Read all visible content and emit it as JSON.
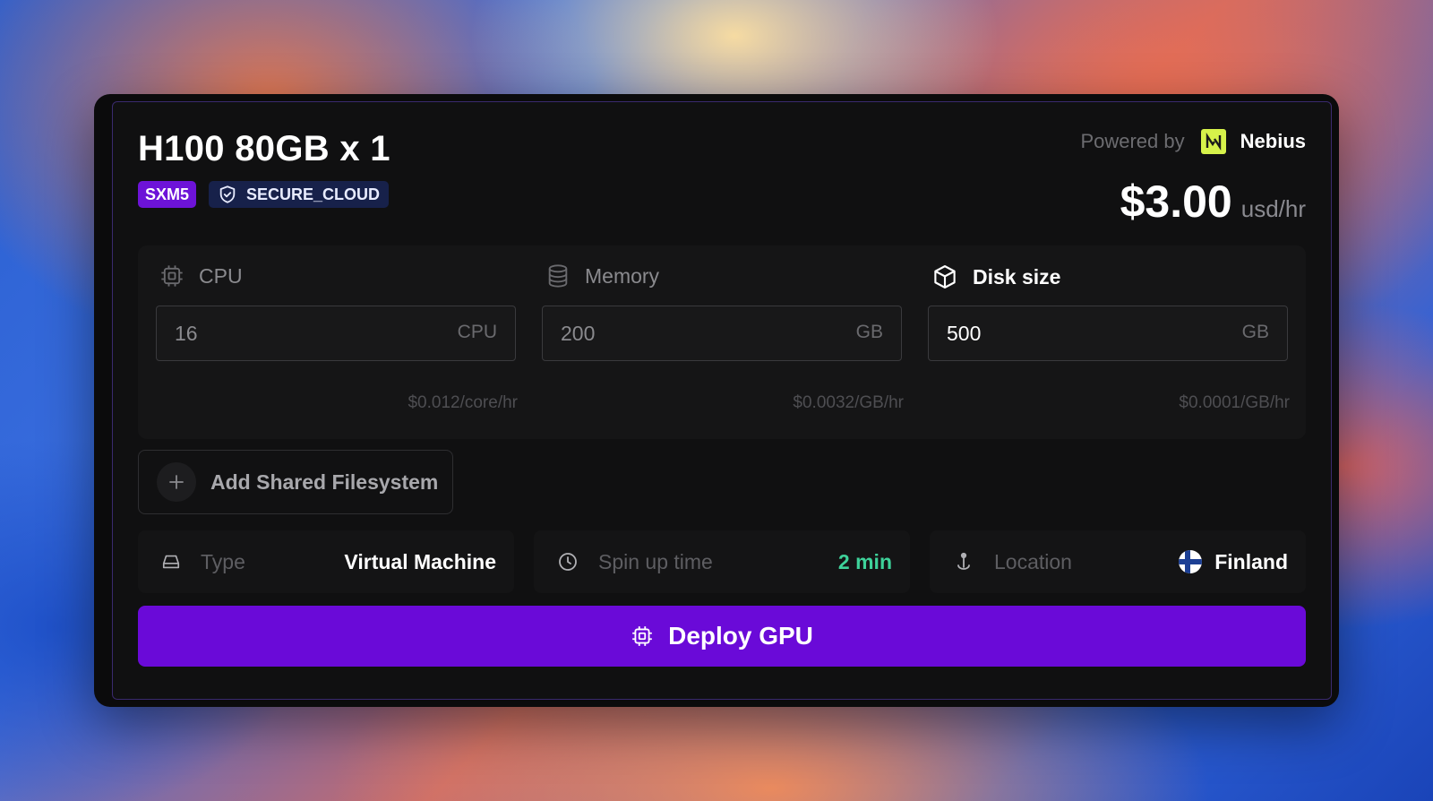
{
  "header": {
    "title": "H100 80GB x 1",
    "badges": {
      "form_factor": "SXM5",
      "cloud_type": "SECURE_CLOUD"
    },
    "powered_by_label": "Powered by",
    "provider_name": "Nebius",
    "price": "$3.00",
    "price_unit": "usd/hr"
  },
  "resources": {
    "cpu": {
      "label": "CPU",
      "value": "16",
      "unit": "CPU",
      "rate": "$0.012/core/hr",
      "icon": "cpu-chip-icon"
    },
    "memory": {
      "label": "Memory",
      "value": "200",
      "unit": "GB",
      "rate": "$0.0032/GB/hr",
      "icon": "database-icon"
    },
    "disk": {
      "label": "Disk size",
      "value": "500",
      "unit": "GB",
      "rate": "$0.0001/GB/hr",
      "icon": "box-icon"
    }
  },
  "shared_fs": {
    "label": "Add Shared Filesystem",
    "icon": "plus-icon"
  },
  "info": {
    "type": {
      "label": "Type",
      "value": "Virtual Machine",
      "icon": "drive-icon"
    },
    "spin_up": {
      "label": "Spin up time",
      "value": "2 min",
      "icon": "clock-icon"
    },
    "location": {
      "label": "Location",
      "value": "Finland",
      "icon": "map-pin-icon"
    }
  },
  "deploy": {
    "label": "Deploy GPU",
    "icon": "cpu-chip-icon"
  },
  "colors": {
    "accent": "#6a0ad8",
    "badge_purple": "#6d13d8",
    "badge_navy": "#17214a",
    "nebius_green": "#d6f24a",
    "spin_up_green": "#3ed29a"
  }
}
